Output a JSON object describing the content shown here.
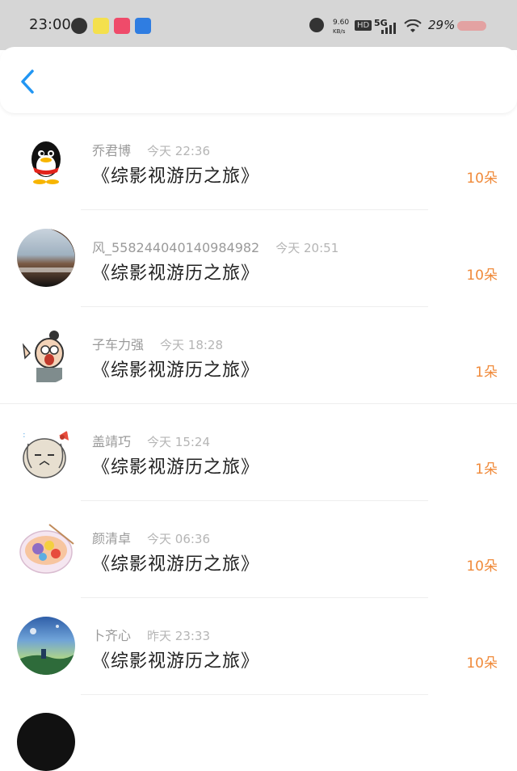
{
  "status_bar": {
    "time": "23:00",
    "net_speed": "9.60",
    "net_unit": "KB/s",
    "hd": "HD",
    "network": "5G",
    "battery": "29%"
  },
  "header": {
    "back_icon": "chevron-left-icon",
    "accent": "#2196f3"
  },
  "gifts": [
    {
      "name": "乔君博",
      "time": "今天 22:36",
      "title": "《综影视游历之旅》",
      "count": "10朵"
    },
    {
      "name": "风_558244040140984982",
      "time": "今天 20:51",
      "title": "《综影视游历之旅》",
      "count": "10朵"
    },
    {
      "name": "子车力强",
      "time": "今天 18:28",
      "title": "《综影视游历之旅》",
      "count": "1朵"
    },
    {
      "name": "盖靖巧",
      "time": "今天 15:24",
      "title": "《综影视游历之旅》",
      "count": "1朵"
    },
    {
      "name": "颜清卓",
      "time": "今天 06:36",
      "title": "《综影视游历之旅》",
      "count": "10朵"
    },
    {
      "name": "卜齐心",
      "time": "昨天 23:33",
      "title": "《综影视游历之旅》",
      "count": "10朵"
    }
  ],
  "colors": {
    "count": "#f08a3a",
    "name": "#9a9a9a",
    "title": "#222222"
  }
}
